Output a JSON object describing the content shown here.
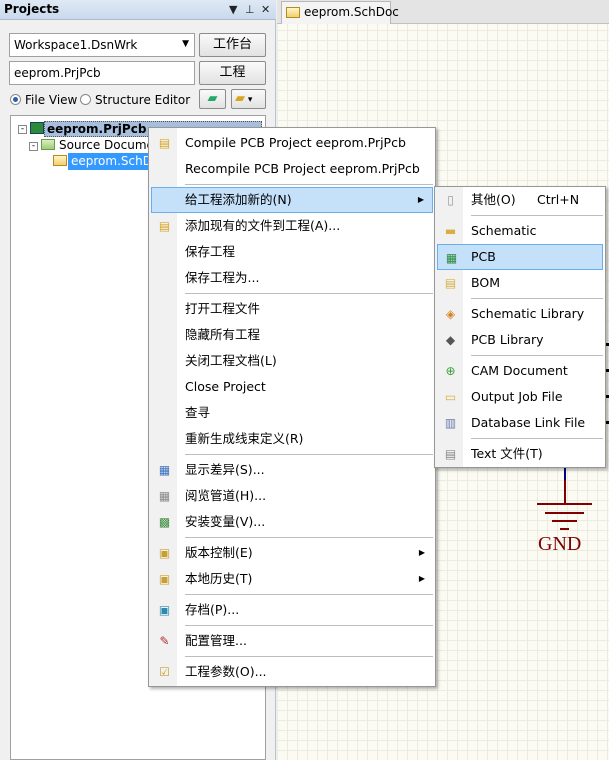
{
  "panel": {
    "title": "Projects",
    "workspace": "Workspace1.DsnWrk",
    "workspace_btn": "工作台",
    "project": "eeprom.PrjPcb",
    "project_btn": "工程",
    "file_view": "File View",
    "structure_editor": "Structure Editor",
    "view_mode": "File View"
  },
  "tree": {
    "project": "eeprom.PrjPcb",
    "folder": "Source Documents",
    "doc": "eeprom.SchDoc"
  },
  "editor": {
    "tab": "eeprom.SchDoc",
    "gnd_label": "GND"
  },
  "colors": {
    "highlight": "#c5e1fa",
    "tree_selection": "#3399ff",
    "gnd": "#800000"
  },
  "context_menu": [
    {
      "label": "Compile PCB Project eeprom.PrjPcb",
      "icon": "compile-icon"
    },
    {
      "label": "Recompile PCB Project eeprom.PrjPcb",
      "icon": ""
    },
    {
      "sep": true
    },
    {
      "label": "给工程添加新的(N)",
      "icon": "",
      "submenu": true,
      "highlighted": true
    },
    {
      "label": "添加现有的文件到工程(A)...",
      "icon": "add-file-icon"
    },
    {
      "label": "保存工程",
      "icon": ""
    },
    {
      "label": "保存工程为...",
      "icon": ""
    },
    {
      "sep": true
    },
    {
      "label": "打开工程文件",
      "icon": ""
    },
    {
      "label": "隐藏所有工程",
      "icon": ""
    },
    {
      "label": "关闭工程文档(L)",
      "icon": ""
    },
    {
      "label": "Close Project",
      "icon": ""
    },
    {
      "label": "查寻",
      "icon": ""
    },
    {
      "label": "重新生成线束定义(R)",
      "icon": ""
    },
    {
      "sep": true
    },
    {
      "label": "显示差异(S)...",
      "icon": "compare-icon"
    },
    {
      "label": "阅览管道(H)...",
      "icon": "browse-channels-icon"
    },
    {
      "label": "安装变量(V)...",
      "icon": "variants-icon"
    },
    {
      "sep": true
    },
    {
      "label": "版本控制(E)",
      "icon": "lock-icon",
      "submenu": true
    },
    {
      "label": "本地历史(T)",
      "icon": "lock-icon",
      "submenu": true
    },
    {
      "sep": true
    },
    {
      "label": "存档(P)...",
      "icon": "archive-icon"
    },
    {
      "sep": true
    },
    {
      "label": "配置管理...",
      "icon": "config-icon"
    },
    {
      "sep": true
    },
    {
      "label": "工程参数(O)...",
      "icon": "project-options-icon"
    }
  ],
  "submenu": [
    {
      "label": "其他(O)",
      "shortcut": "Ctrl+N",
      "icon": "blank-doc-icon"
    },
    {
      "sep": true
    },
    {
      "label": "Schematic",
      "icon": "schematic-icon"
    },
    {
      "label": "PCB",
      "icon": "pcb-icon",
      "highlighted": true
    },
    {
      "label": "BOM",
      "icon": "bom-icon"
    },
    {
      "sep": true
    },
    {
      "label": "Schematic Library",
      "icon": "schlib-icon"
    },
    {
      "label": "PCB Library",
      "icon": "pcblib-icon"
    },
    {
      "sep": true
    },
    {
      "label": "CAM Document",
      "icon": "cam-icon"
    },
    {
      "label": "Output Job File",
      "icon": "output-job-icon"
    },
    {
      "label": "Database Link File",
      "icon": "dblink-icon"
    },
    {
      "sep": true
    },
    {
      "label": "Text  文件(T)",
      "icon": "text-doc-icon"
    }
  ]
}
